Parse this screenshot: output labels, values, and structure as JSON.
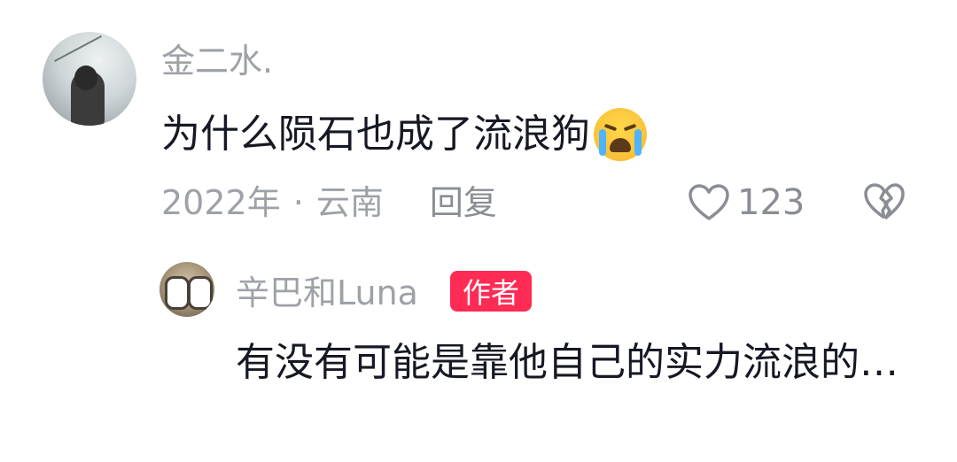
{
  "comment": {
    "username": "金二水.",
    "text": "为什么陨石也成了流浪狗",
    "emoji": "loudly-crying-face",
    "year": "2022年",
    "separator": "·",
    "location": "云南",
    "reply_label": "回复",
    "like_count": "123"
  },
  "reply": {
    "username": "辛巴和Luna",
    "author_badge": "作者",
    "text": "有没有可能是靠他自己的实力流浪的…"
  },
  "colors": {
    "badge": "#fe2c55",
    "muted_text": "#9ea2a8",
    "body_text": "#161823"
  },
  "icons": [
    "heart-icon",
    "broken-heart-icon"
  ]
}
